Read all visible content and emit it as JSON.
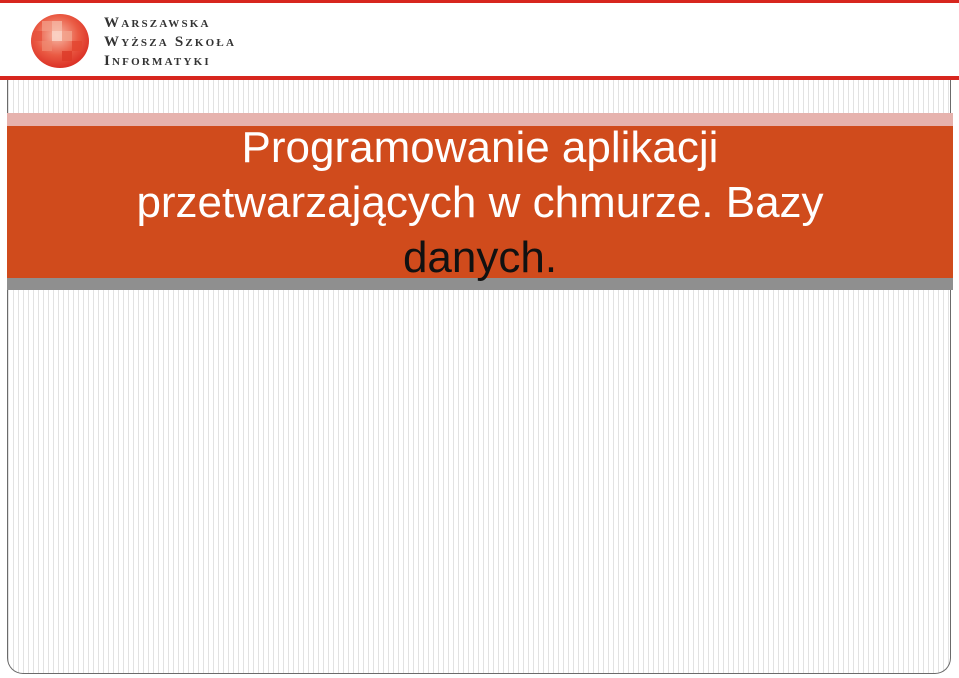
{
  "header": {
    "logo_lines": [
      "Warszawska",
      "Wyższa Szkoła",
      "Informatyki"
    ],
    "logo_icon": "wwsi-mosaic-logo-icon",
    "accent_color": "#d7261e"
  },
  "slide": {
    "title_lines": [
      "Programowanie aplikacji",
      "przetwarzających w chmurze. Bazy",
      "danych."
    ],
    "title_band_color": "#d04b1c"
  }
}
